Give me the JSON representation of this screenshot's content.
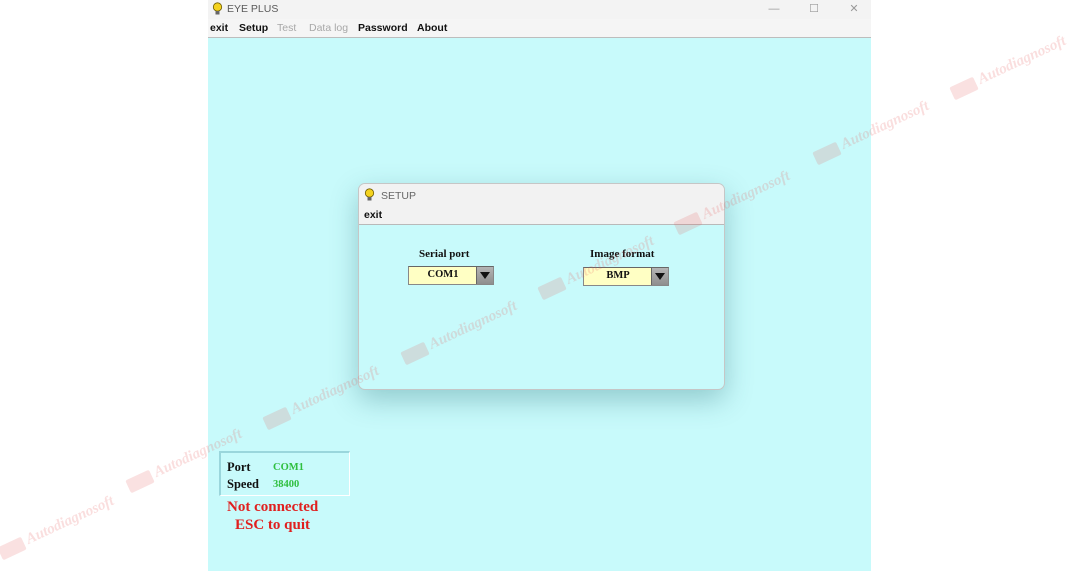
{
  "window": {
    "title": "EYE PLUS",
    "controls": {
      "minimize": "—",
      "maximize": "☐",
      "close": "✕"
    }
  },
  "menu": {
    "items": [
      {
        "label": "exit",
        "enabled": true
      },
      {
        "label": "Setup",
        "enabled": true
      },
      {
        "label": "Test",
        "enabled": false
      },
      {
        "label": "Data log",
        "enabled": false
      },
      {
        "label": "Password",
        "enabled": true
      },
      {
        "label": "About",
        "enabled": true
      }
    ]
  },
  "setup_dialog": {
    "title": "SETUP",
    "menu_exit": "exit",
    "serial_port": {
      "label": "Serial port",
      "value": "COM1"
    },
    "image_format": {
      "label": "Image format",
      "value": "BMP"
    }
  },
  "status": {
    "port_label": "Port",
    "port_value": "COM1",
    "speed_label": "Speed",
    "speed_value": "38400",
    "connection": "Not connected",
    "hint": "ESC to quit"
  },
  "watermark": {
    "text": "Autodiagnosoft"
  },
  "colors": {
    "background": "#c8fafb",
    "combo_fill": "#ffffc4",
    "status_value": "#2fbf3f",
    "error": "#e0201f"
  }
}
